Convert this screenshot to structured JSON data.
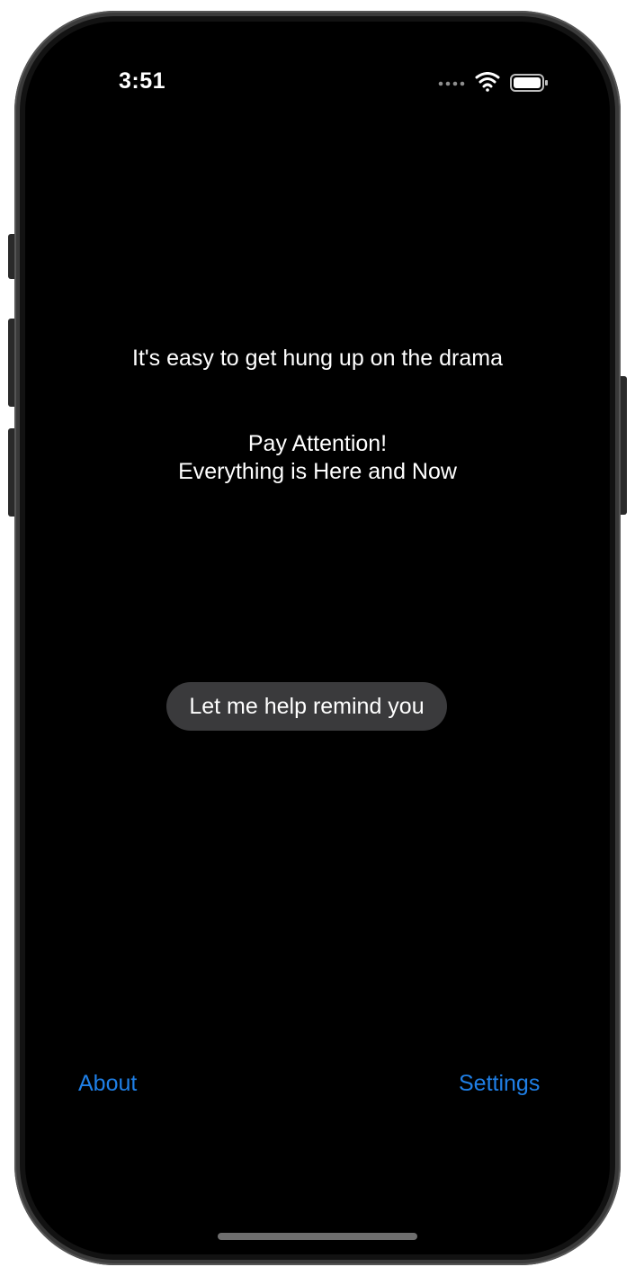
{
  "status_bar": {
    "time": "3:51",
    "icons": [
      "dots-icon",
      "wifi-icon",
      "battery-icon"
    ]
  },
  "content": {
    "tagline": "It's easy to get hung up on the drama",
    "headline_line1": "Pay Attention!",
    "headline_line2": "Everything is Here and Now",
    "remind_button_label": "Let me help remind you"
  },
  "footer": {
    "about_label": "About",
    "settings_label": "Settings"
  },
  "colors": {
    "background": "#000000",
    "link": "#1f7fe6",
    "button_fill": "#3a3a3c",
    "text": "#ffffff"
  }
}
